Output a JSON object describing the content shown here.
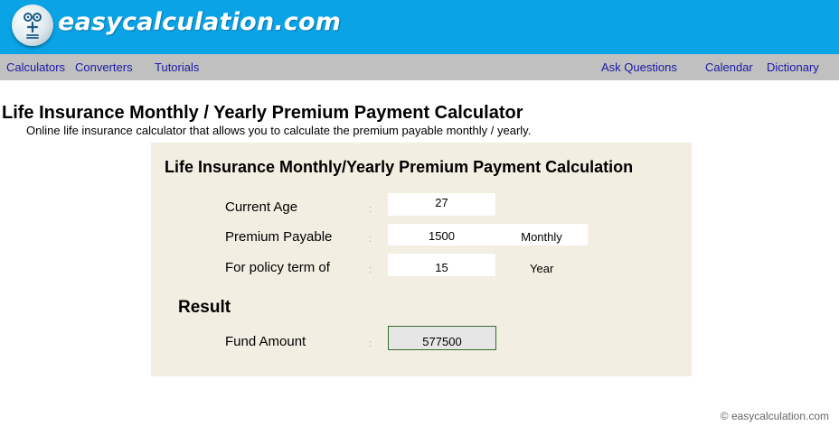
{
  "brand": {
    "name": "easycalculation.com",
    "colors": {
      "header": "#0aa3e6",
      "navbar": "#c0c0c0",
      "link": "#1a1aa6",
      "panel": "#f2eee2",
      "result_border": "#3a6a2a"
    }
  },
  "nav": {
    "left": [
      "Calculators",
      "Converters",
      "Tutorials"
    ],
    "right": [
      "Ask Questions",
      "Calendar",
      "Dictionary"
    ]
  },
  "page": {
    "title": "Life Insurance Monthly / Yearly Premium Payment Calculator",
    "description": "Online life insurance calculator that allows you to calculate the premium payable monthly / yearly."
  },
  "calculator": {
    "title": "Life Insurance Monthly/Yearly Premium Payment Calculation",
    "separator": ":",
    "current_age": {
      "label": "Current Age",
      "value": "27"
    },
    "premium": {
      "label": "Premium Payable",
      "value": "1500",
      "frequency": "Monthly"
    },
    "term": {
      "label": "For policy term of",
      "value": "15",
      "unit": "Year"
    },
    "result": {
      "heading": "Result",
      "label": "Fund Amount",
      "value": "577500"
    }
  },
  "footer": {
    "copyright": "© easycalculation.com"
  }
}
